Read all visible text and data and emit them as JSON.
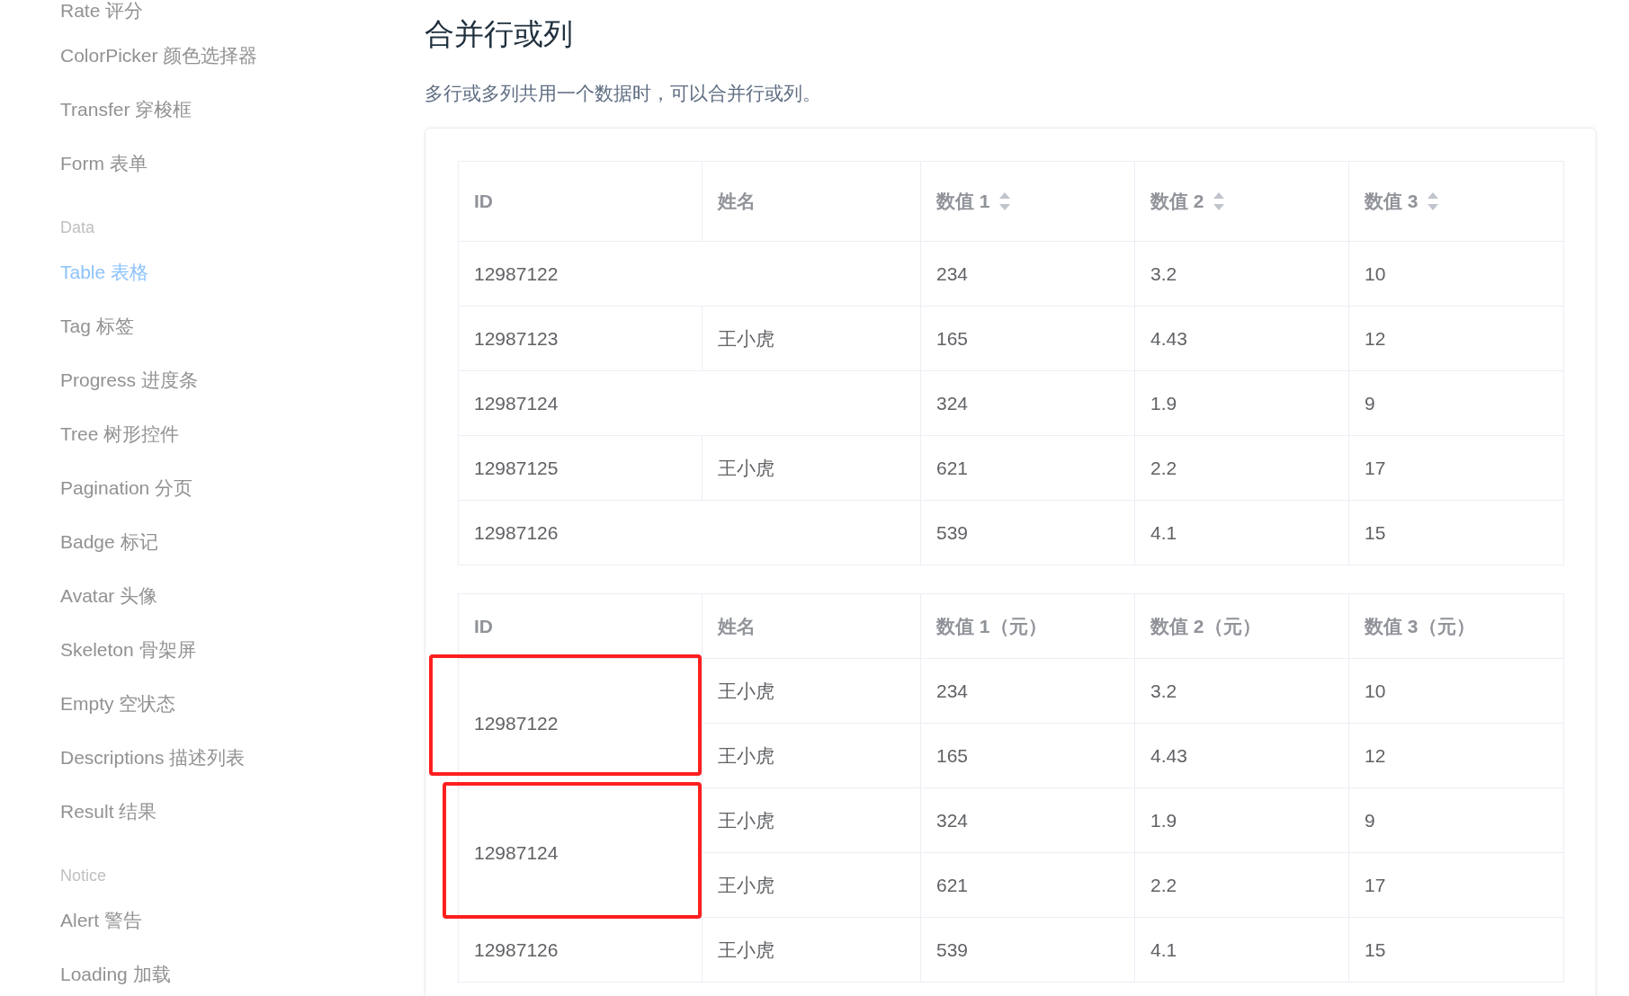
{
  "sidebar": {
    "sections": [
      {
        "items": [
          {
            "label": "Rate 评分",
            "selected": false
          },
          {
            "label": "ColorPicker 颜色选择器",
            "selected": false
          },
          {
            "label": "Transfer 穿梭框",
            "selected": false
          },
          {
            "label": "Form 表单",
            "selected": false
          }
        ]
      },
      {
        "heading": "Data",
        "items": [
          {
            "label": "Table 表格",
            "selected": true
          },
          {
            "label": "Tag 标签",
            "selected": false
          },
          {
            "label": "Progress 进度条",
            "selected": false
          },
          {
            "label": "Tree 树形控件",
            "selected": false
          },
          {
            "label": "Pagination 分页",
            "selected": false
          },
          {
            "label": "Badge 标记",
            "selected": false
          },
          {
            "label": "Avatar 头像",
            "selected": false
          },
          {
            "label": "Skeleton 骨架屏",
            "selected": false
          },
          {
            "label": "Empty 空状态",
            "selected": false
          },
          {
            "label": "Descriptions 描述列表",
            "selected": false
          },
          {
            "label": "Result 结果",
            "selected": false
          }
        ]
      },
      {
        "heading": "Notice",
        "items": [
          {
            "label": "Alert 警告",
            "selected": false
          },
          {
            "label": "Loading 加载",
            "selected": false
          }
        ]
      }
    ]
  },
  "section": {
    "title": "合并行或列",
    "description": "多行或多列共用一个数据时，可以合并行或列。"
  },
  "tables": [
    {
      "columns": [
        {
          "label": "ID",
          "sortable": false
        },
        {
          "label": "姓名",
          "sortable": false
        },
        {
          "label": "数值 1",
          "sortable": true
        },
        {
          "label": "数值 2",
          "sortable": true
        },
        {
          "label": "数值 3",
          "sortable": true
        }
      ],
      "rows": [
        {
          "cells": [
            {
              "text": "12987122",
              "colspan": 2
            },
            {
              "text": "234"
            },
            {
              "text": "3.2"
            },
            {
              "text": "10"
            }
          ]
        },
        {
          "cells": [
            {
              "text": "12987123"
            },
            {
              "text": "王小虎"
            },
            {
              "text": "165"
            },
            {
              "text": "4.43"
            },
            {
              "text": "12"
            }
          ]
        },
        {
          "cells": [
            {
              "text": "12987124",
              "colspan": 2
            },
            {
              "text": "324"
            },
            {
              "text": "1.9"
            },
            {
              "text": "9"
            }
          ]
        },
        {
          "cells": [
            {
              "text": "12987125"
            },
            {
              "text": "王小虎"
            },
            {
              "text": "621"
            },
            {
              "text": "2.2"
            },
            {
              "text": "17"
            }
          ]
        },
        {
          "cells": [
            {
              "text": "12987126",
              "colspan": 2
            },
            {
              "text": "539"
            },
            {
              "text": "4.1"
            },
            {
              "text": "15"
            }
          ]
        }
      ]
    },
    {
      "columns": [
        {
          "label": "ID"
        },
        {
          "label": "姓名"
        },
        {
          "label": "数值 1（元）"
        },
        {
          "label": "数值 2（元）"
        },
        {
          "label": "数值 3（元）"
        }
      ],
      "rows": [
        {
          "cells": [
            {
              "text": "12987122",
              "rowspan": 2,
              "annotated": true
            },
            {
              "text": "王小虎"
            },
            {
              "text": "234"
            },
            {
              "text": "3.2"
            },
            {
              "text": "10"
            }
          ]
        },
        {
          "cells": [
            {
              "text": "王小虎"
            },
            {
              "text": "165"
            },
            {
              "text": "4.43"
            },
            {
              "text": "12"
            }
          ]
        },
        {
          "cells": [
            {
              "text": "12987124",
              "rowspan": 2,
              "annotated": true
            },
            {
              "text": "王小虎"
            },
            {
              "text": "324"
            },
            {
              "text": "1.9"
            },
            {
              "text": "9"
            }
          ]
        },
        {
          "cells": [
            {
              "text": "王小虎"
            },
            {
              "text": "621"
            },
            {
              "text": "2.2"
            },
            {
              "text": "17"
            }
          ]
        },
        {
          "cells": [
            {
              "text": "12987126",
              "annotated": false
            },
            {
              "text": "王小虎"
            },
            {
              "text": "539"
            },
            {
              "text": "4.1"
            },
            {
              "text": "15"
            }
          ]
        }
      ]
    }
  ]
}
